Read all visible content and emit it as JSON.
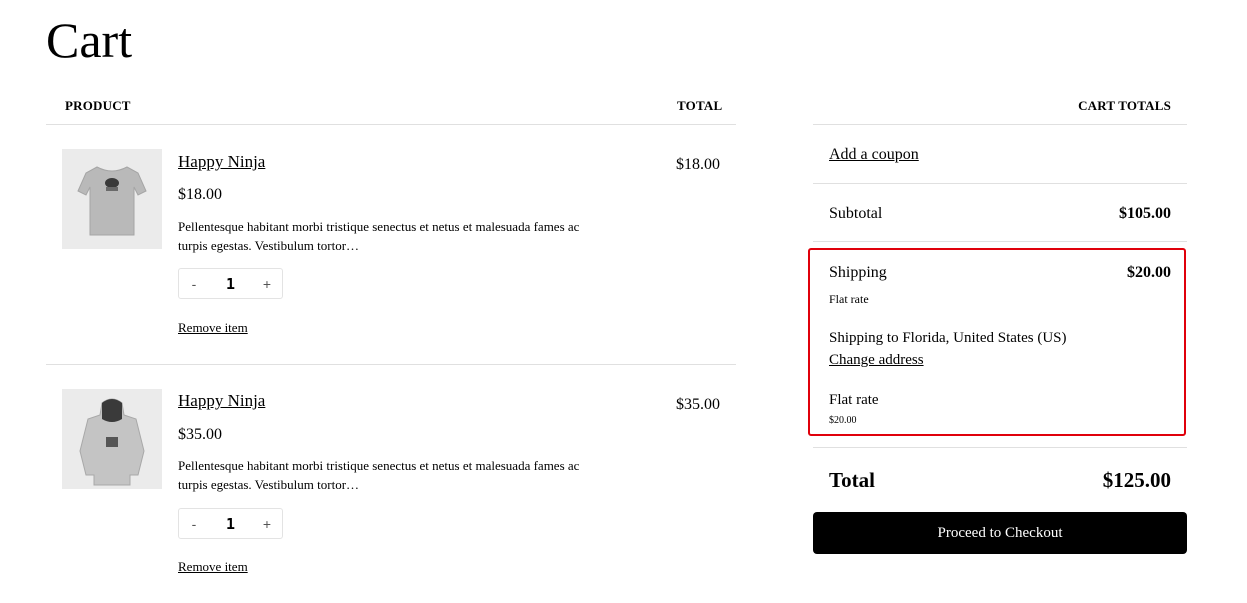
{
  "page": {
    "title": "Cart"
  },
  "table": {
    "col_product": "PRODUCT",
    "col_total": "TOTAL"
  },
  "items": [
    {
      "name": "Happy Ninja",
      "price": "$18.00",
      "description": "Pellentesque habitant morbi tristique senectus et netus et malesuada fames ac turpis egestas. Vestibulum tortor…",
      "qty": "1",
      "total": "$18.00",
      "remove_label": "Remove item",
      "minus": "-",
      "plus": "+",
      "image_icon": "tshirt-icon"
    },
    {
      "name": "Happy Ninja",
      "price": "$35.00",
      "description": "Pellentesque habitant morbi tristique senectus et netus et malesuada fames ac turpis egestas. Vestibulum tortor…",
      "qty": "1",
      "total": "$35.00",
      "remove_label": "Remove item",
      "minus": "-",
      "plus": "+",
      "image_icon": "hoodie-icon"
    }
  ],
  "totals": {
    "heading": "CART TOTALS",
    "coupon_link": "Add a coupon",
    "subtotal_label": "Subtotal",
    "subtotal_value": "$105.00",
    "shipping_label": "Shipping",
    "shipping_value": "$20.00",
    "shipping_method": "Flat rate",
    "shipping_to": "Shipping to Florida, United States (US)",
    "change_address": "Change address",
    "option_label": "Flat rate",
    "option_price": "$20.00",
    "total_label": "Total",
    "total_value": "$125.00",
    "checkout_button": "Proceed to Checkout"
  },
  "colors": {
    "highlight": "#e0000b",
    "button_bg": "#000000",
    "divider": "#e0e0e0"
  }
}
